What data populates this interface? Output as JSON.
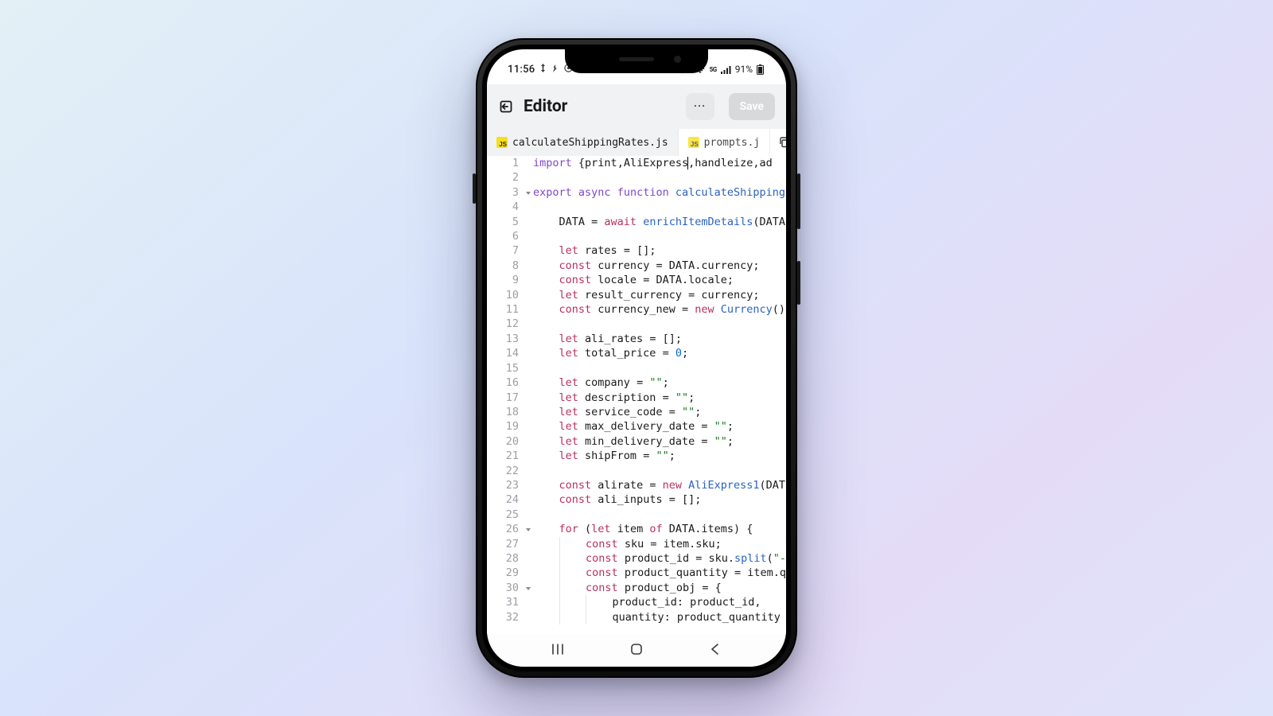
{
  "statusbar": {
    "time": "11:56",
    "battery_text": "91%"
  },
  "header": {
    "title": "Editor",
    "more_label": "···",
    "save_label": "Save"
  },
  "tabs": {
    "active": "calculateShippingRates.js",
    "inactive": "prompts.j"
  },
  "code": {
    "lines": [
      {
        "n": "1",
        "fold": false,
        "indent": 0,
        "tokens": [
          [
            "kw",
            "import "
          ],
          [
            "punc",
            "{"
          ],
          [
            "ident",
            "print"
          ],
          [
            "punc",
            ","
          ],
          [
            "ident",
            "AliExpress"
          ],
          [
            "cursor",
            ""
          ],
          [
            "punc",
            ","
          ],
          [
            "ident",
            "handleize"
          ],
          [
            "punc",
            ","
          ],
          [
            "ident",
            "ad"
          ]
        ]
      },
      {
        "n": "2",
        "fold": false,
        "indent": 0,
        "tokens": []
      },
      {
        "n": "3",
        "fold": true,
        "indent": 0,
        "tokens": [
          [
            "kw",
            "export "
          ],
          [
            "kw",
            "async "
          ],
          [
            "kw",
            "function "
          ],
          [
            "fn",
            "calculateShipping"
          ]
        ]
      },
      {
        "n": "4",
        "fold": false,
        "indent": 0,
        "tokens": []
      },
      {
        "n": "5",
        "fold": false,
        "indent": 1,
        "tokens": [
          [
            "ident",
            "DATA "
          ],
          [
            "punc",
            "= "
          ],
          [
            "kw2",
            "await "
          ],
          [
            "fn",
            "enrichItemDetails"
          ],
          [
            "punc",
            "("
          ],
          [
            "ident",
            "DATA"
          ]
        ]
      },
      {
        "n": "6",
        "fold": false,
        "indent": 0,
        "tokens": []
      },
      {
        "n": "7",
        "fold": false,
        "indent": 1,
        "tokens": [
          [
            "kw2",
            "let "
          ],
          [
            "ident",
            "rates "
          ],
          [
            "punc",
            "= [];"
          ]
        ]
      },
      {
        "n": "8",
        "fold": false,
        "indent": 1,
        "tokens": [
          [
            "kw2",
            "const "
          ],
          [
            "ident",
            "currency "
          ],
          [
            "punc",
            "= "
          ],
          [
            "ident",
            "DATA"
          ],
          [
            "punc",
            "."
          ],
          [
            "ident",
            "currency"
          ],
          [
            "punc",
            ";"
          ]
        ]
      },
      {
        "n": "9",
        "fold": false,
        "indent": 1,
        "tokens": [
          [
            "kw2",
            "const "
          ],
          [
            "ident",
            "locale "
          ],
          [
            "punc",
            "= "
          ],
          [
            "ident",
            "DATA"
          ],
          [
            "punc",
            "."
          ],
          [
            "ident",
            "locale"
          ],
          [
            "punc",
            ";"
          ]
        ]
      },
      {
        "n": "10",
        "fold": false,
        "indent": 1,
        "tokens": [
          [
            "kw2",
            "let "
          ],
          [
            "ident",
            "result_currency "
          ],
          [
            "punc",
            "= "
          ],
          [
            "ident",
            "currency"
          ],
          [
            "punc",
            ";"
          ]
        ]
      },
      {
        "n": "11",
        "fold": false,
        "indent": 1,
        "tokens": [
          [
            "kw2",
            "const "
          ],
          [
            "ident",
            "currency_new "
          ],
          [
            "punc",
            "= "
          ],
          [
            "kw2",
            "new "
          ],
          [
            "fn",
            "Currency"
          ],
          [
            "punc",
            "()"
          ]
        ]
      },
      {
        "n": "12",
        "fold": false,
        "indent": 0,
        "tokens": []
      },
      {
        "n": "13",
        "fold": false,
        "indent": 1,
        "tokens": [
          [
            "kw2",
            "let "
          ],
          [
            "ident",
            "ali_rates "
          ],
          [
            "punc",
            "= [];"
          ]
        ]
      },
      {
        "n": "14",
        "fold": false,
        "indent": 1,
        "tokens": [
          [
            "kw2",
            "let "
          ],
          [
            "ident",
            "total_price "
          ],
          [
            "punc",
            "= "
          ],
          [
            "num",
            "0"
          ],
          [
            "punc",
            ";"
          ]
        ]
      },
      {
        "n": "15",
        "fold": false,
        "indent": 0,
        "tokens": []
      },
      {
        "n": "16",
        "fold": false,
        "indent": 1,
        "tokens": [
          [
            "kw2",
            "let "
          ],
          [
            "ident",
            "company "
          ],
          [
            "punc",
            "= "
          ],
          [
            "str",
            "\"\""
          ],
          [
            "punc",
            ";"
          ]
        ]
      },
      {
        "n": "17",
        "fold": false,
        "indent": 1,
        "tokens": [
          [
            "kw2",
            "let "
          ],
          [
            "ident",
            "description "
          ],
          [
            "punc",
            "= "
          ],
          [
            "str",
            "\"\""
          ],
          [
            "punc",
            ";"
          ]
        ]
      },
      {
        "n": "18",
        "fold": false,
        "indent": 1,
        "tokens": [
          [
            "kw2",
            "let "
          ],
          [
            "ident",
            "service_code "
          ],
          [
            "punc",
            "= "
          ],
          [
            "str",
            "\"\""
          ],
          [
            "punc",
            ";"
          ]
        ]
      },
      {
        "n": "19",
        "fold": false,
        "indent": 1,
        "tokens": [
          [
            "kw2",
            "let "
          ],
          [
            "ident",
            "max_delivery_date "
          ],
          [
            "punc",
            "= "
          ],
          [
            "str",
            "\"\""
          ],
          [
            "punc",
            ";"
          ]
        ]
      },
      {
        "n": "20",
        "fold": false,
        "indent": 1,
        "tokens": [
          [
            "kw2",
            "let "
          ],
          [
            "ident",
            "min_delivery_date "
          ],
          [
            "punc",
            "= "
          ],
          [
            "str",
            "\"\""
          ],
          [
            "punc",
            ";"
          ]
        ]
      },
      {
        "n": "21",
        "fold": false,
        "indent": 1,
        "tokens": [
          [
            "kw2",
            "let "
          ],
          [
            "ident",
            "shipFrom "
          ],
          [
            "punc",
            "= "
          ],
          [
            "str",
            "\"\""
          ],
          [
            "punc",
            ";"
          ]
        ]
      },
      {
        "n": "22",
        "fold": false,
        "indent": 0,
        "tokens": []
      },
      {
        "n": "23",
        "fold": false,
        "indent": 1,
        "tokens": [
          [
            "kw2",
            "const "
          ],
          [
            "ident",
            "alirate "
          ],
          [
            "punc",
            "= "
          ],
          [
            "kw2",
            "new "
          ],
          [
            "fn",
            "AliExpress1"
          ],
          [
            "punc",
            "("
          ],
          [
            "ident",
            "DAT"
          ]
        ]
      },
      {
        "n": "24",
        "fold": false,
        "indent": 1,
        "tokens": [
          [
            "kw2",
            "const "
          ],
          [
            "ident",
            "ali_inputs "
          ],
          [
            "punc",
            "= [];"
          ]
        ]
      },
      {
        "n": "25",
        "fold": false,
        "indent": 0,
        "tokens": []
      },
      {
        "n": "26",
        "fold": true,
        "indent": 1,
        "tokens": [
          [
            "kw2",
            "for "
          ],
          [
            "punc",
            "("
          ],
          [
            "kw2",
            "let "
          ],
          [
            "ident",
            "item "
          ],
          [
            "kw2",
            "of "
          ],
          [
            "ident",
            "DATA"
          ],
          [
            "punc",
            "."
          ],
          [
            "ident",
            "items"
          ],
          [
            "punc",
            ") {"
          ]
        ]
      },
      {
        "n": "27",
        "fold": false,
        "indent": 2,
        "tokens": [
          [
            "kw2",
            "const "
          ],
          [
            "ident",
            "sku "
          ],
          [
            "punc",
            "= "
          ],
          [
            "ident",
            "item"
          ],
          [
            "punc",
            "."
          ],
          [
            "ident",
            "sku"
          ],
          [
            "punc",
            ";"
          ]
        ]
      },
      {
        "n": "28",
        "fold": false,
        "indent": 2,
        "tokens": [
          [
            "kw2",
            "const "
          ],
          [
            "ident",
            "product_id "
          ],
          [
            "punc",
            "= "
          ],
          [
            "ident",
            "sku"
          ],
          [
            "punc",
            "."
          ],
          [
            "fn",
            "split"
          ],
          [
            "punc",
            "("
          ],
          [
            "str",
            "\"-"
          ]
        ]
      },
      {
        "n": "29",
        "fold": false,
        "indent": 2,
        "tokens": [
          [
            "kw2",
            "const "
          ],
          [
            "ident",
            "product_quantity "
          ],
          [
            "punc",
            "= "
          ],
          [
            "ident",
            "item"
          ],
          [
            "punc",
            "."
          ],
          [
            "ident",
            "q"
          ]
        ]
      },
      {
        "n": "30",
        "fold": true,
        "indent": 2,
        "tokens": [
          [
            "kw2",
            "const "
          ],
          [
            "ident",
            "product_obj "
          ],
          [
            "punc",
            "= {"
          ]
        ]
      },
      {
        "n": "31",
        "fold": false,
        "indent": 3,
        "tokens": [
          [
            "ident",
            "product_id"
          ],
          [
            "punc",
            ": "
          ],
          [
            "ident",
            "product_id"
          ],
          [
            "punc",
            ","
          ]
        ]
      },
      {
        "n": "32",
        "fold": false,
        "indent": 3,
        "tokens": [
          [
            "ident",
            "quantity"
          ],
          [
            "punc",
            ": "
          ],
          [
            "ident",
            "product_quantity"
          ]
        ]
      }
    ]
  }
}
